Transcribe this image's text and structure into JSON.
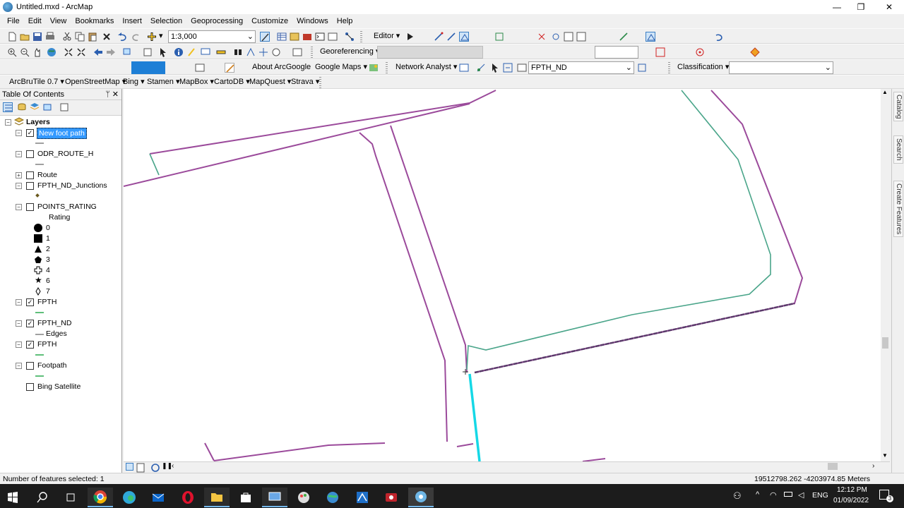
{
  "window": {
    "title": "Untitled.mxd - ArcMap",
    "minimize": "—",
    "maximize": "❐",
    "close": "✕"
  },
  "menu": [
    "File",
    "Edit",
    "View",
    "Bookmarks",
    "Insert",
    "Selection",
    "Geoprocessing",
    "Customize",
    "Windows",
    "Help"
  ],
  "toolbar1": {
    "scale": "1:3,000",
    "editor": "Editor"
  },
  "toolbar2": {
    "georeferencing": "Georeferencing"
  },
  "toolbar3": {
    "about_arcgoogle": "About ArcGoogle",
    "google_maps": "Google Maps",
    "network_analyst": "Network Analyst",
    "network_dataset": "FPTH_ND",
    "classification": "Classification"
  },
  "toolbar4": {
    "items": [
      "ArcBruTile 0.7",
      "OpenStreetMap",
      "Bing",
      "Stamen",
      "MapBox",
      "CartoDB",
      "MapQuest",
      "Strava"
    ]
  },
  "toc": {
    "title": "Table Of Contents",
    "pin": "ᛘ",
    "close": "✕",
    "root": "Layers",
    "layers": [
      {
        "name": "New foot path",
        "checked": true,
        "selected": true,
        "color": "#a0a0a0"
      },
      {
        "name": "ODR_ROUTE_H",
        "checked": false,
        "color": "#a0a0a0"
      },
      {
        "name": "Route",
        "checked": false
      },
      {
        "name": "FPTH_ND_Junctions",
        "checked": false,
        "color": "#6b5a1e"
      },
      {
        "name": "POINTS_RATING",
        "checked": false,
        "sublabel": "Rating"
      },
      {
        "name": "FPTH",
        "checked": true,
        "color": "#5fbf7a"
      },
      {
        "name": "FPTH_ND",
        "checked": true,
        "sublabel": "Edges",
        "color": "#a0a0a0"
      },
      {
        "name": "FPTH",
        "checked": true,
        "color": "#5fbf7a"
      },
      {
        "name": "Footpath",
        "checked": false,
        "color": "#5fbf7a"
      },
      {
        "name": "Bing Satellite",
        "checked": false
      }
    ],
    "ratings": [
      "0",
      "1",
      "2",
      "3",
      "4",
      "6",
      "7"
    ]
  },
  "side_tabs": [
    "Catalog",
    "Search",
    "Create Features"
  ],
  "status": {
    "selected": "Number of features selected: 1",
    "coords": "19512798.262  -4203974.85 Meters"
  },
  "taskbar": {
    "language": "ENG",
    "time": "12:12 PM",
    "date": "01/09/2022",
    "notifications": "3",
    "apps": [
      "start",
      "search",
      "task-view",
      "chrome",
      "edge",
      "mail",
      "opera",
      "file-explorer",
      "store",
      "remote-desktop",
      "paint",
      "globe",
      "arcmap-blue",
      "recorder",
      "arcmap"
    ]
  },
  "colors": {
    "road_outline": "#9b4a9b",
    "footpath": "#4aa58a",
    "selected_edge": "#15d8e6",
    "toc_selected": "#3399ff"
  }
}
